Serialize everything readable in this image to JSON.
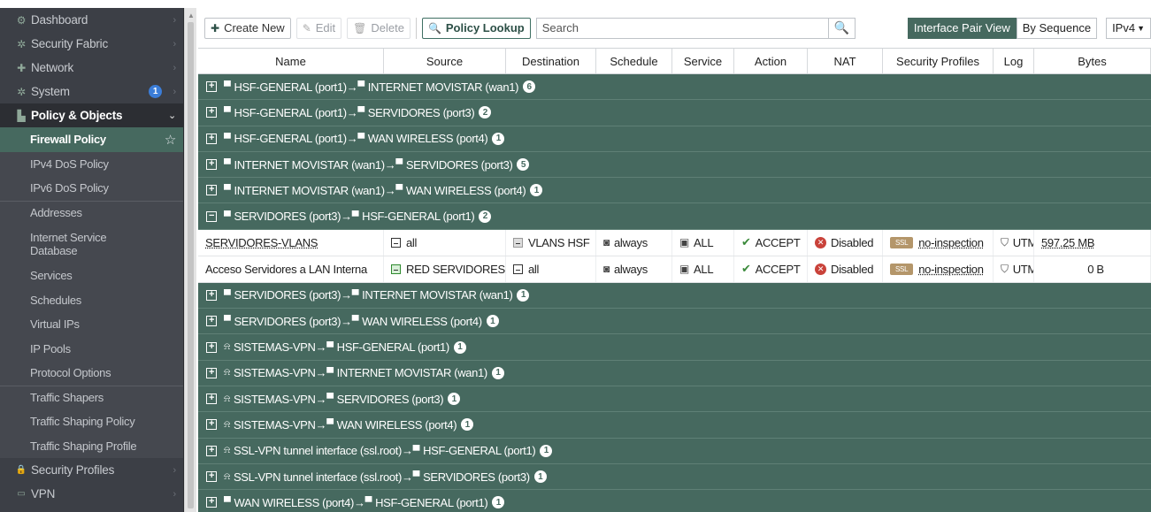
{
  "sidebar": {
    "top_items": [
      {
        "label": "Dashboard",
        "icon": "dashboard-icon",
        "glyph": "⚙"
      },
      {
        "label": "Security Fabric",
        "icon": "fabric-icon",
        "glyph": "✲"
      },
      {
        "label": "Network",
        "icon": "network-icon",
        "glyph": "✚"
      },
      {
        "label": "System",
        "icon": "gear-icon",
        "glyph": "✲",
        "badge": "1"
      },
      {
        "label": "Policy & Objects",
        "icon": "policy-icon",
        "glyph": "▙",
        "active": true
      }
    ],
    "sub_items": [
      {
        "label": "Firewall Policy",
        "selected": true
      },
      {
        "label": "IPv4 DoS Policy"
      },
      {
        "label": "IPv6 DoS Policy"
      },
      {
        "label": "Addresses",
        "sep": true
      },
      {
        "label": "Internet Service Database",
        "two_line": true
      },
      {
        "label": "Services"
      },
      {
        "label": "Schedules"
      },
      {
        "label": "Virtual IPs"
      },
      {
        "label": "IP Pools"
      },
      {
        "label": "Protocol Options"
      },
      {
        "label": "Traffic Shapers",
        "sep": true
      },
      {
        "label": "Traffic Shaping Policy"
      },
      {
        "label": "Traffic Shaping Profile"
      }
    ],
    "bottom_items": [
      {
        "label": "Security Profiles",
        "icon": "lock-icon",
        "glyph": "🔒"
      },
      {
        "label": "VPN",
        "icon": "monitor-icon",
        "glyph": "▭"
      }
    ]
  },
  "toolbar": {
    "create_new": "Create New",
    "edit": "Edit",
    "delete": "Delete",
    "policy_lookup": "Policy Lookup",
    "search_placeholder": "Search",
    "interface_pair_view": "Interface Pair View",
    "by_sequence": "By Sequence",
    "ip_version": "IPv4"
  },
  "table": {
    "columns": [
      "Name",
      "Source",
      "Destination",
      "Schedule",
      "Service",
      "Action",
      "NAT",
      "Security Profiles",
      "Log",
      "Bytes"
    ],
    "groups_before": [
      {
        "src": "HSF-GENERAL (port1)",
        "dst": "INTERNET MOVISTAR (wan1)",
        "count": "6"
      },
      {
        "src": "HSF-GENERAL (port1)",
        "dst": "SERVIDORES (port3)",
        "count": "2"
      },
      {
        "src": "HSF-GENERAL (port1)",
        "dst": "WAN WIRELESS (port4)",
        "count": "1"
      },
      {
        "src": "INTERNET MOVISTAR (wan1)",
        "dst": "SERVIDORES (port3)",
        "count": "5"
      },
      {
        "src": "INTERNET MOVISTAR (wan1)",
        "dst": "WAN WIRELESS (port4)",
        "count": "1"
      }
    ],
    "expanded_group": {
      "src": "SERVIDORES (port3)",
      "dst": "HSF-GENERAL (port1)",
      "count": "2"
    },
    "policies": [
      {
        "name": "SERVIDORES-VLANS",
        "source": "all",
        "destination": "VLANS HSF",
        "schedule": "always",
        "service": "ALL",
        "action": "ACCEPT",
        "nat": "Disabled",
        "profile_badge": "SSL",
        "profile": "no-inspection",
        "log": "UTM",
        "bytes": "597.25 MB"
      },
      {
        "name": "Acceso Servidores a LAN Interna",
        "source": "RED SERVIDORES",
        "destination": "all",
        "schedule": "always",
        "service": "ALL",
        "action": "ACCEPT",
        "nat": "Disabled",
        "profile_badge": "SSL",
        "profile": "no-inspection",
        "log": "UTM",
        "bytes": "0 B"
      }
    ],
    "groups_after": [
      {
        "src": "SERVIDORES (port3)",
        "dst": "INTERNET MOVISTAR (wan1)",
        "count": "1",
        "vpn": false
      },
      {
        "src": "SERVIDORES (port3)",
        "dst": "WAN WIRELESS (port4)",
        "count": "1",
        "vpn": false
      },
      {
        "src": "SISTEMAS-VPN",
        "dst": "HSF-GENERAL (port1)",
        "count": "1",
        "vpn": true
      },
      {
        "src": "SISTEMAS-VPN",
        "dst": "INTERNET MOVISTAR (wan1)",
        "count": "1",
        "vpn": true
      },
      {
        "src": "SISTEMAS-VPN",
        "dst": "SERVIDORES (port3)",
        "count": "1",
        "vpn": true
      },
      {
        "src": "SISTEMAS-VPN",
        "dst": "WAN WIRELESS (port4)",
        "count": "1",
        "vpn": true
      },
      {
        "src": "SSL-VPN tunnel interface (ssl.root)",
        "dst": "HSF-GENERAL (port1)",
        "count": "1",
        "vpn": true
      },
      {
        "src": "SSL-VPN tunnel interface (ssl.root)",
        "dst": "SERVIDORES (port3)",
        "count": "1",
        "vpn": true
      },
      {
        "src": "WAN WIRELESS (port4)",
        "dst": "HSF-GENERAL (port1)",
        "count": "1",
        "vpn": false
      }
    ]
  },
  "colors": {
    "accent": "#46695f",
    "sidebar_bg": "#3c3f46",
    "accept": "#3b8a3b",
    "disabled_red": "#c9423a"
  }
}
